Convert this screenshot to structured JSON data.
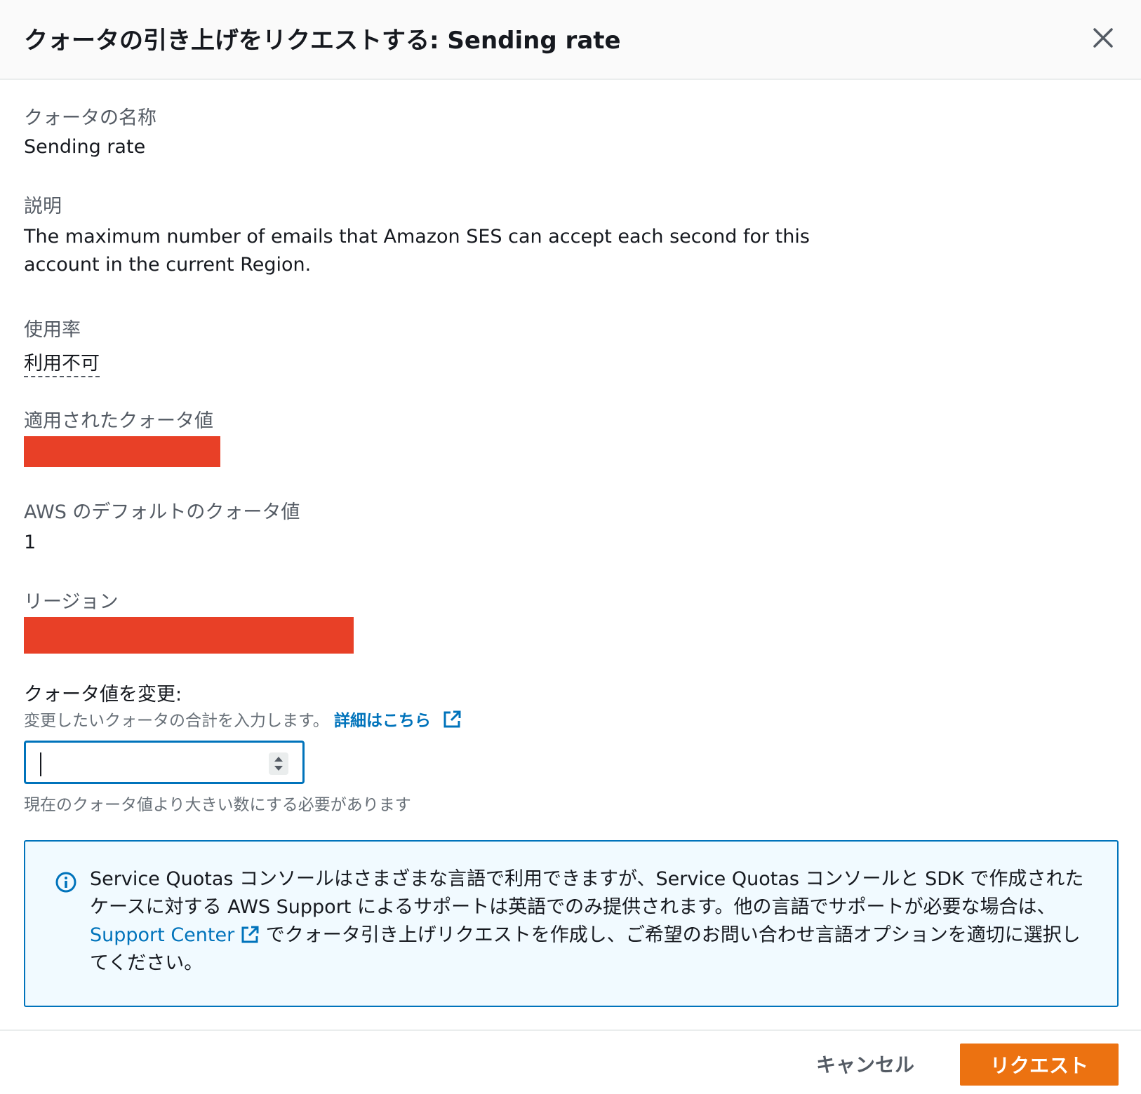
{
  "header": {
    "title": "クォータの引き上げをリクエストする: Sending rate",
    "close_icon": "close-icon"
  },
  "quota_name": {
    "label": "クォータの名称",
    "value": "Sending rate"
  },
  "description": {
    "label": "説明",
    "value": "The maximum number of emails that Amazon SES can accept each second for this account in the current Region."
  },
  "utilization": {
    "label": "使用率",
    "value": "利用不可"
  },
  "applied_value": {
    "label": "適用されたクォータ値"
  },
  "default_value": {
    "label": "AWS のデフォルトのクォータ値",
    "value": "1"
  },
  "region": {
    "label": "リージョン"
  },
  "change_quota": {
    "label": "クォータ値を変更:",
    "description": "変更したいクォータの合計を入力します。",
    "link_label": "詳細はこちら",
    "input_value": "",
    "constraint": "現在のクォータ値より大きい数にする必要があります"
  },
  "info": {
    "text_part1": "Service Quotas コンソールはさまざまな言語で利用できますが、Service Quotas コンソールと SDK で作成されたケースに対する AWS Support によるサポートは英語でのみ提供されます。他の言語でサポートが必要な場合は、",
    "link_label": "Support Center",
    "text_part2": "でクォータ引き上げリクエストを作成し、ご希望のお問い合わせ言語オプションを適切に選択してください。"
  },
  "footer": {
    "cancel_label": "キャンセル",
    "request_label": "リクエスト"
  },
  "colors": {
    "primary_button": "#ec7211",
    "link": "#0073bb",
    "info_border": "#0073bb",
    "info_background": "#f1faff",
    "redaction": "#e84027"
  }
}
